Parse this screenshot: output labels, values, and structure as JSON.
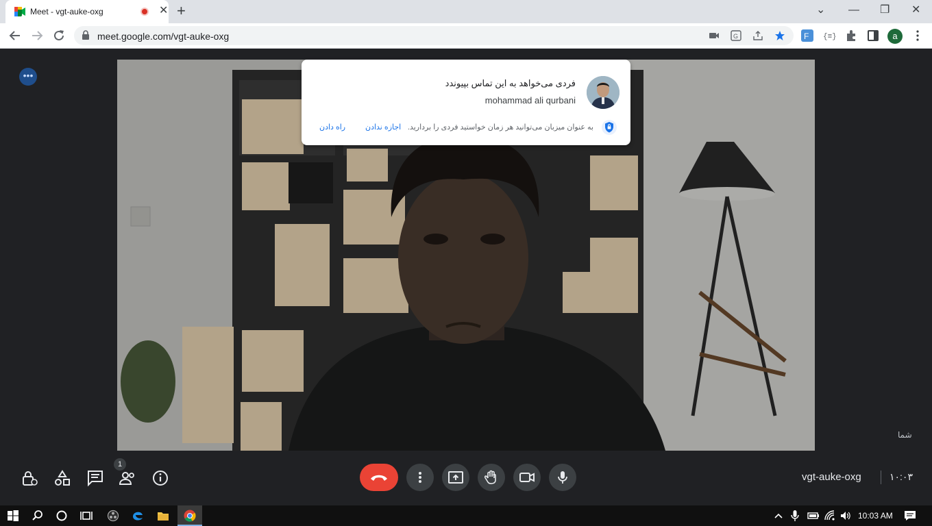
{
  "browser": {
    "tab_title": "Meet - vgt-auke-oxg",
    "tab_close": "✕",
    "new_tab": "+",
    "url": "meet.google.com/vgt-auke-oxg",
    "window_min": "—",
    "window_restore": "❐",
    "window_close": "✕",
    "chevron": "⌄"
  },
  "join_request": {
    "message": "فردی می‌خواهد به این تماس بپیوندد",
    "name": "mohammad ali qurbani",
    "host_note": "به عنوان میزبان می‌توانید هر زمان خواستید فردی را بردارید.",
    "admit_label": "اجازه ندادن",
    "deny_label": "راه دادن"
  },
  "video": {
    "self_label": "شما"
  },
  "controls": {
    "participants_badge": "1",
    "meeting_code": "vgt-auke-oxg",
    "time": "۱۰:۰۳"
  },
  "taskbar": {
    "time": "10:03 AM"
  }
}
